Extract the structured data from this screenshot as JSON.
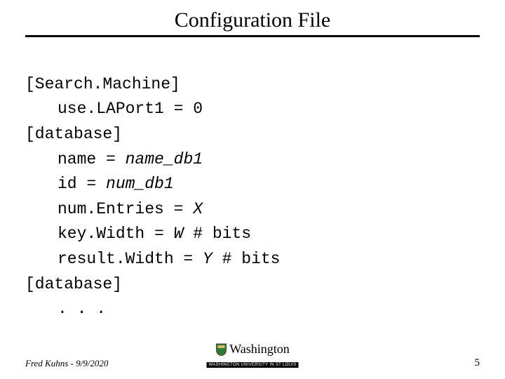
{
  "title": "Configuration File",
  "code": {
    "l1": "[Search.Machine]",
    "l2": "use.LAPort1 = 0",
    "l3": "[database]",
    "l4a": "name = ",
    "l4b": "name_db1",
    "l5a": "id = ",
    "l5b": "num_db1",
    "l6a": "num.Entries = ",
    "l6b": "X",
    "l7a": "key.Width = ",
    "l7b": "W",
    "l7c": " # bits",
    "l8a": "result.Width = ",
    "l8b": "Y",
    "l8c": " # bits",
    "l9": "[database]",
    "l10": ". . ."
  },
  "footer": {
    "author_date": "Fred Kuhns - 9/9/2020",
    "org": "Washington",
    "org_sub": "WASHINGTON UNIVERSITY IN ST LOUIS",
    "page_num": "5"
  }
}
